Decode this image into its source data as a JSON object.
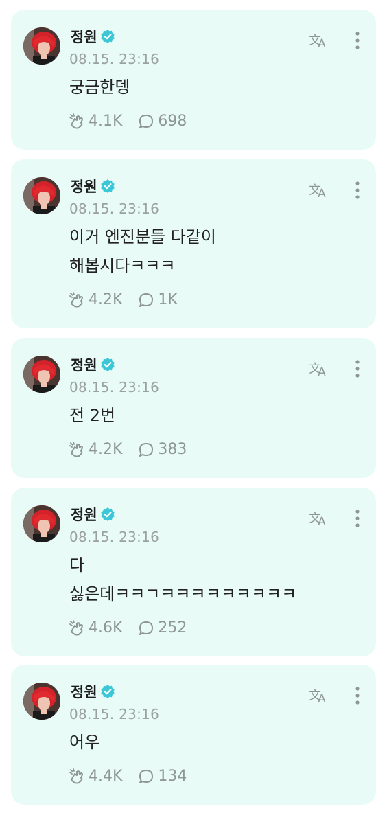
{
  "colors": {
    "card_bg": "#e8fbf7",
    "verified": "#3bc7d6",
    "muted": "#9aa1a0",
    "text": "#222222"
  },
  "icons": {
    "translate": "translate-icon",
    "more": "more-vertical-icon",
    "reaction": "reaction-hand-icon",
    "comment": "comment-bubble-icon",
    "verified": "verified-badge-icon"
  },
  "posts": [
    {
      "author": "정원",
      "date": "08.15. 23:16",
      "lines": [
        "궁금한뎅"
      ],
      "likes": "4.1K",
      "comments": "698"
    },
    {
      "author": "정원",
      "date": "08.15. 23:16",
      "lines": [
        "이거 엔진분들 다같이",
        "해봅시다ㅋㅋㅋ"
      ],
      "likes": "4.2K",
      "comments": "1K"
    },
    {
      "author": "정원",
      "date": "08.15. 23:16",
      "lines": [
        "전 2번"
      ],
      "likes": "4.2K",
      "comments": "383"
    },
    {
      "author": "정원",
      "date": "08.15. 23:16",
      "lines": [
        "다",
        "싫은데ㅋㅋㄱㅋㅋㅋㅋㅋㅋㅋㅋㅋ"
      ],
      "likes": "4.6K",
      "comments": "252"
    },
    {
      "author": "정원",
      "date": "08.15. 23:16",
      "lines": [
        "어우"
      ],
      "likes": "4.4K",
      "comments": "134"
    }
  ]
}
